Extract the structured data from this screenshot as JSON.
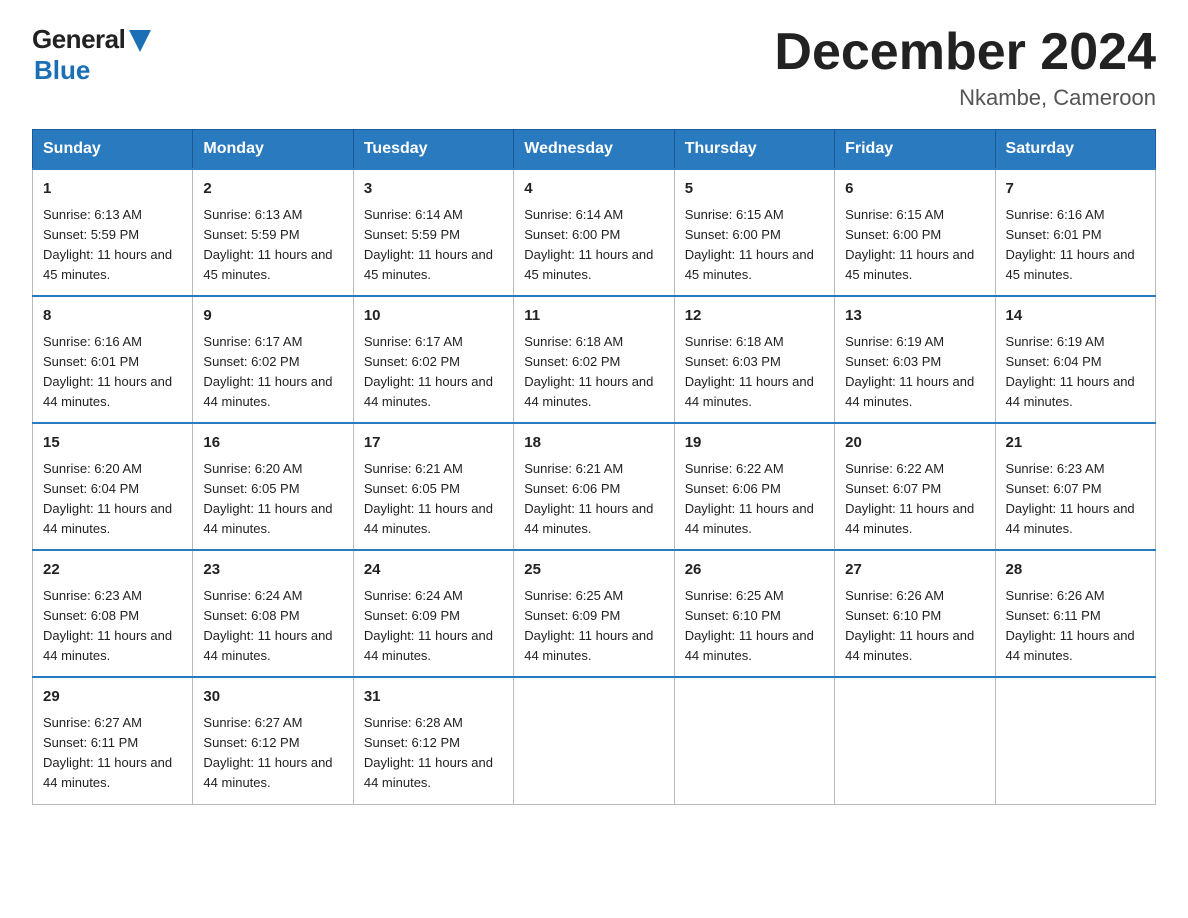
{
  "logo": {
    "general": "General",
    "blue": "Blue"
  },
  "title": {
    "main": "December 2024",
    "sub": "Nkambe, Cameroon"
  },
  "headers": [
    "Sunday",
    "Monday",
    "Tuesday",
    "Wednesday",
    "Thursday",
    "Friday",
    "Saturday"
  ],
  "weeks": [
    [
      {
        "day": "1",
        "sunrise": "6:13 AM",
        "sunset": "5:59 PM",
        "daylight": "11 hours and 45 minutes."
      },
      {
        "day": "2",
        "sunrise": "6:13 AM",
        "sunset": "5:59 PM",
        "daylight": "11 hours and 45 minutes."
      },
      {
        "day": "3",
        "sunrise": "6:14 AM",
        "sunset": "5:59 PM",
        "daylight": "11 hours and 45 minutes."
      },
      {
        "day": "4",
        "sunrise": "6:14 AM",
        "sunset": "6:00 PM",
        "daylight": "11 hours and 45 minutes."
      },
      {
        "day": "5",
        "sunrise": "6:15 AM",
        "sunset": "6:00 PM",
        "daylight": "11 hours and 45 minutes."
      },
      {
        "day": "6",
        "sunrise": "6:15 AM",
        "sunset": "6:00 PM",
        "daylight": "11 hours and 45 minutes."
      },
      {
        "day": "7",
        "sunrise": "6:16 AM",
        "sunset": "6:01 PM",
        "daylight": "11 hours and 45 minutes."
      }
    ],
    [
      {
        "day": "8",
        "sunrise": "6:16 AM",
        "sunset": "6:01 PM",
        "daylight": "11 hours and 44 minutes."
      },
      {
        "day": "9",
        "sunrise": "6:17 AM",
        "sunset": "6:02 PM",
        "daylight": "11 hours and 44 minutes."
      },
      {
        "day": "10",
        "sunrise": "6:17 AM",
        "sunset": "6:02 PM",
        "daylight": "11 hours and 44 minutes."
      },
      {
        "day": "11",
        "sunrise": "6:18 AM",
        "sunset": "6:02 PM",
        "daylight": "11 hours and 44 minutes."
      },
      {
        "day": "12",
        "sunrise": "6:18 AM",
        "sunset": "6:03 PM",
        "daylight": "11 hours and 44 minutes."
      },
      {
        "day": "13",
        "sunrise": "6:19 AM",
        "sunset": "6:03 PM",
        "daylight": "11 hours and 44 minutes."
      },
      {
        "day": "14",
        "sunrise": "6:19 AM",
        "sunset": "6:04 PM",
        "daylight": "11 hours and 44 minutes."
      }
    ],
    [
      {
        "day": "15",
        "sunrise": "6:20 AM",
        "sunset": "6:04 PM",
        "daylight": "11 hours and 44 minutes."
      },
      {
        "day": "16",
        "sunrise": "6:20 AM",
        "sunset": "6:05 PM",
        "daylight": "11 hours and 44 minutes."
      },
      {
        "day": "17",
        "sunrise": "6:21 AM",
        "sunset": "6:05 PM",
        "daylight": "11 hours and 44 minutes."
      },
      {
        "day": "18",
        "sunrise": "6:21 AM",
        "sunset": "6:06 PM",
        "daylight": "11 hours and 44 minutes."
      },
      {
        "day": "19",
        "sunrise": "6:22 AM",
        "sunset": "6:06 PM",
        "daylight": "11 hours and 44 minutes."
      },
      {
        "day": "20",
        "sunrise": "6:22 AM",
        "sunset": "6:07 PM",
        "daylight": "11 hours and 44 minutes."
      },
      {
        "day": "21",
        "sunrise": "6:23 AM",
        "sunset": "6:07 PM",
        "daylight": "11 hours and 44 minutes."
      }
    ],
    [
      {
        "day": "22",
        "sunrise": "6:23 AM",
        "sunset": "6:08 PM",
        "daylight": "11 hours and 44 minutes."
      },
      {
        "day": "23",
        "sunrise": "6:24 AM",
        "sunset": "6:08 PM",
        "daylight": "11 hours and 44 minutes."
      },
      {
        "day": "24",
        "sunrise": "6:24 AM",
        "sunset": "6:09 PM",
        "daylight": "11 hours and 44 minutes."
      },
      {
        "day": "25",
        "sunrise": "6:25 AM",
        "sunset": "6:09 PM",
        "daylight": "11 hours and 44 minutes."
      },
      {
        "day": "26",
        "sunrise": "6:25 AM",
        "sunset": "6:10 PM",
        "daylight": "11 hours and 44 minutes."
      },
      {
        "day": "27",
        "sunrise": "6:26 AM",
        "sunset": "6:10 PM",
        "daylight": "11 hours and 44 minutes."
      },
      {
        "day": "28",
        "sunrise": "6:26 AM",
        "sunset": "6:11 PM",
        "daylight": "11 hours and 44 minutes."
      }
    ],
    [
      {
        "day": "29",
        "sunrise": "6:27 AM",
        "sunset": "6:11 PM",
        "daylight": "11 hours and 44 minutes."
      },
      {
        "day": "30",
        "sunrise": "6:27 AM",
        "sunset": "6:12 PM",
        "daylight": "11 hours and 44 minutes."
      },
      {
        "day": "31",
        "sunrise": "6:28 AM",
        "sunset": "6:12 PM",
        "daylight": "11 hours and 44 minutes."
      },
      null,
      null,
      null,
      null
    ]
  ],
  "labels": {
    "sunrise": "Sunrise:",
    "sunset": "Sunset:",
    "daylight": "Daylight:"
  }
}
